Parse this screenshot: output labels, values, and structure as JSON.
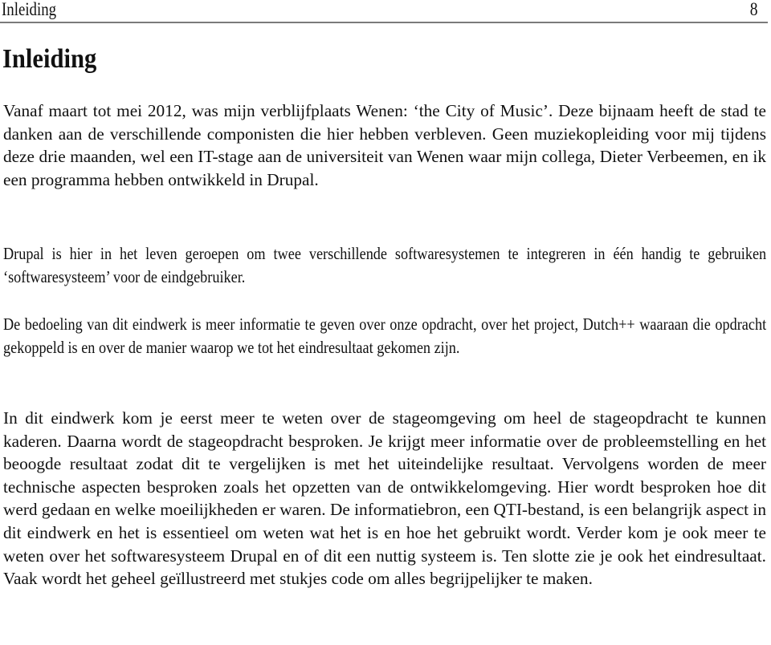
{
  "header": {
    "running_title": "Inleiding",
    "page_number": "8"
  },
  "chapter": {
    "title": "Inleiding"
  },
  "paragraphs": [
    "Vanaf maart tot mei 2012, was mijn verblijfplaats Wenen: ‘the City of Music’. Deze bijnaam heeft de stad te danken aan de verschillende componisten die hier hebben verbleven. Geen muziekopleiding voor mij tijdens deze drie maanden, wel een IT-stage aan de universiteit van Wenen waar mijn collega, Dieter Verbeemen, en ik een programma hebben ontwikkeld in Drupal.",
    "Drupal is hier in het leven geroepen om twee verschillende softwaresystemen te integreren in één handig te gebruiken ‘softwaresysteem’ voor de eindgebruiker.",
    "De bedoeling van dit eindwerk is meer informatie te geven over onze opdracht, over het project, Dutch++ waaraan die opdracht gekoppeld is en over de manier waarop we tot het eindresultaat gekomen zijn.",
    "In dit eindwerk kom je eerst meer te weten over de stageomgeving om heel de stageopdracht te kunnen kaderen. Daarna wordt de stageopdracht besproken. Je krijgt meer informatie over de probleemstelling en het beoogde resultaat zodat dit te vergelijken is met het uiteindelijke resultaat. Vervolgens worden de meer technische aspecten besproken zoals het opzetten van de ontwikkelomgeving. Hier wordt besproken hoe dit werd gedaan en welke moeilijkheden er waren. De informatiebron, een QTI-bestand, is een belangrijk aspect in dit eindwerk en het is essentieel om weten wat het is en hoe het gebruikt wordt. Verder kom je ook meer te weten over het softwaresysteem Drupal en of dit een nuttig systeem is. Ten slotte zie je ook het eindresultaat. Vaak wordt het geheel geïllustreerd met stukjes code om alles begrijpelijker te maken."
  ]
}
